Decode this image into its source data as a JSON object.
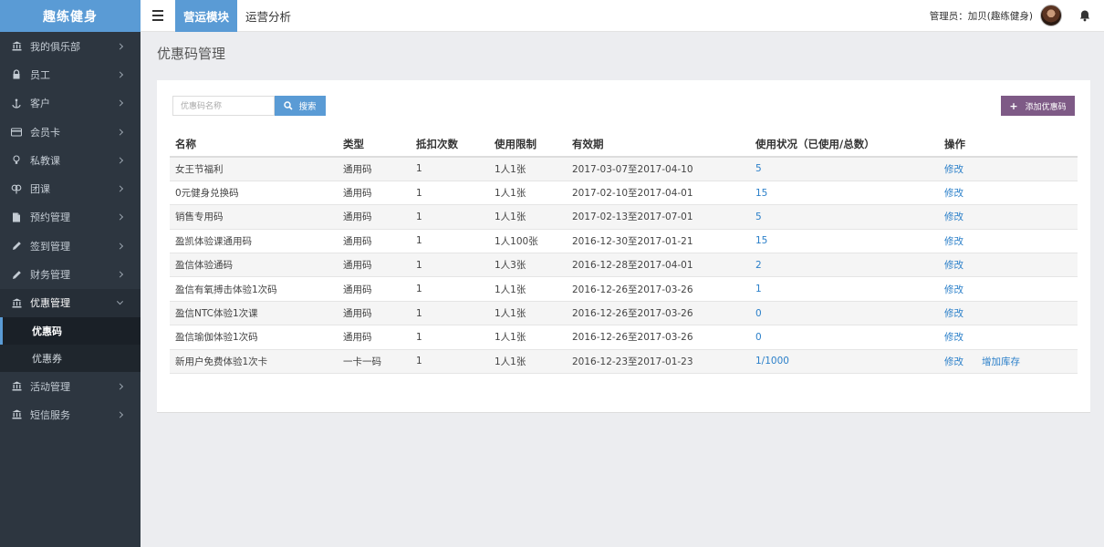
{
  "app": {
    "logo": "趣练健身"
  },
  "topbar": {
    "nav": [
      {
        "label": "营运模块",
        "active": true
      },
      {
        "label": "运营分析",
        "active": false
      }
    ],
    "admin": "管理员：加贝(趣练健身)"
  },
  "sidebar": {
    "items": [
      {
        "label": "我的俱乐部",
        "icon": "bank-icon"
      },
      {
        "label": "员工",
        "icon": "lock-icon"
      },
      {
        "label": "客户",
        "icon": "anchor-icon"
      },
      {
        "label": "会员卡",
        "icon": "card-icon"
      },
      {
        "label": "私教课",
        "icon": "lightbulb-icon"
      },
      {
        "label": "团课",
        "icon": "group-icon"
      },
      {
        "label": "预约管理",
        "icon": "file-icon"
      },
      {
        "label": "签到管理",
        "icon": "pencil-icon"
      },
      {
        "label": "财务管理",
        "icon": "pencil-icon"
      },
      {
        "label": "优惠管理",
        "icon": "bank-icon",
        "open": true
      },
      {
        "label": "活动管理",
        "icon": "bank-icon"
      },
      {
        "label": "短信服务",
        "icon": "bank-icon"
      }
    ],
    "sub_items": [
      {
        "label": "优惠码",
        "active": true
      },
      {
        "label": "优惠券",
        "active": false
      }
    ]
  },
  "main": {
    "title": "优惠码管理",
    "search": {
      "placeholder": "优惠码名称",
      "button": "搜索"
    },
    "add_button": "添加优惠码",
    "table": {
      "headers": [
        "名称",
        "类型",
        "抵扣次数",
        "使用限制",
        "有效期",
        "使用状况（已使用/总数）",
        "操作"
      ],
      "rows": [
        {
          "name": "女王节福利",
          "type": "通用码",
          "times": "1",
          "limit": "1人1张",
          "period": "2017-03-07至2017-04-10",
          "usage": "5",
          "actions": [
            "修改"
          ]
        },
        {
          "name": "0元健身兑换码",
          "type": "通用码",
          "times": "1",
          "limit": "1人1张",
          "period": "2017-02-10至2017-04-01",
          "usage": "15",
          "actions": [
            "修改"
          ]
        },
        {
          "name": "销售专用码",
          "type": "通用码",
          "times": "1",
          "limit": "1人1张",
          "period": "2017-02-13至2017-07-01",
          "usage": "5",
          "actions": [
            "修改"
          ]
        },
        {
          "name": "盈凯体验课通用码",
          "type": "通用码",
          "times": "1",
          "limit": "1人100张",
          "period": "2016-12-30至2017-01-21",
          "usage": "15",
          "actions": [
            "修改"
          ]
        },
        {
          "name": "盈信体验通码",
          "type": "通用码",
          "times": "1",
          "limit": "1人3张",
          "period": "2016-12-28至2017-04-01",
          "usage": "2",
          "actions": [
            "修改"
          ]
        },
        {
          "name": "盈信有氧搏击体验1次码",
          "type": "通用码",
          "times": "1",
          "limit": "1人1张",
          "period": "2016-12-26至2017-03-26",
          "usage": "1",
          "actions": [
            "修改"
          ]
        },
        {
          "name": "盈信NTC体验1次课",
          "type": "通用码",
          "times": "1",
          "limit": "1人1张",
          "period": "2016-12-26至2017-03-26",
          "usage": "0",
          "actions": [
            "修改"
          ]
        },
        {
          "name": "盈信瑜伽体验1次码",
          "type": "通用码",
          "times": "1",
          "limit": "1人1张",
          "period": "2016-12-26至2017-03-26",
          "usage": "0",
          "actions": [
            "修改"
          ]
        },
        {
          "name": "新用户免费体验1次卡",
          "type": "一卡一码",
          "times": "1",
          "limit": "1人1张",
          "period": "2016-12-23至2017-01-23",
          "usage": "1/1000",
          "actions": [
            "修改",
            "增加库存"
          ]
        }
      ]
    }
  }
}
